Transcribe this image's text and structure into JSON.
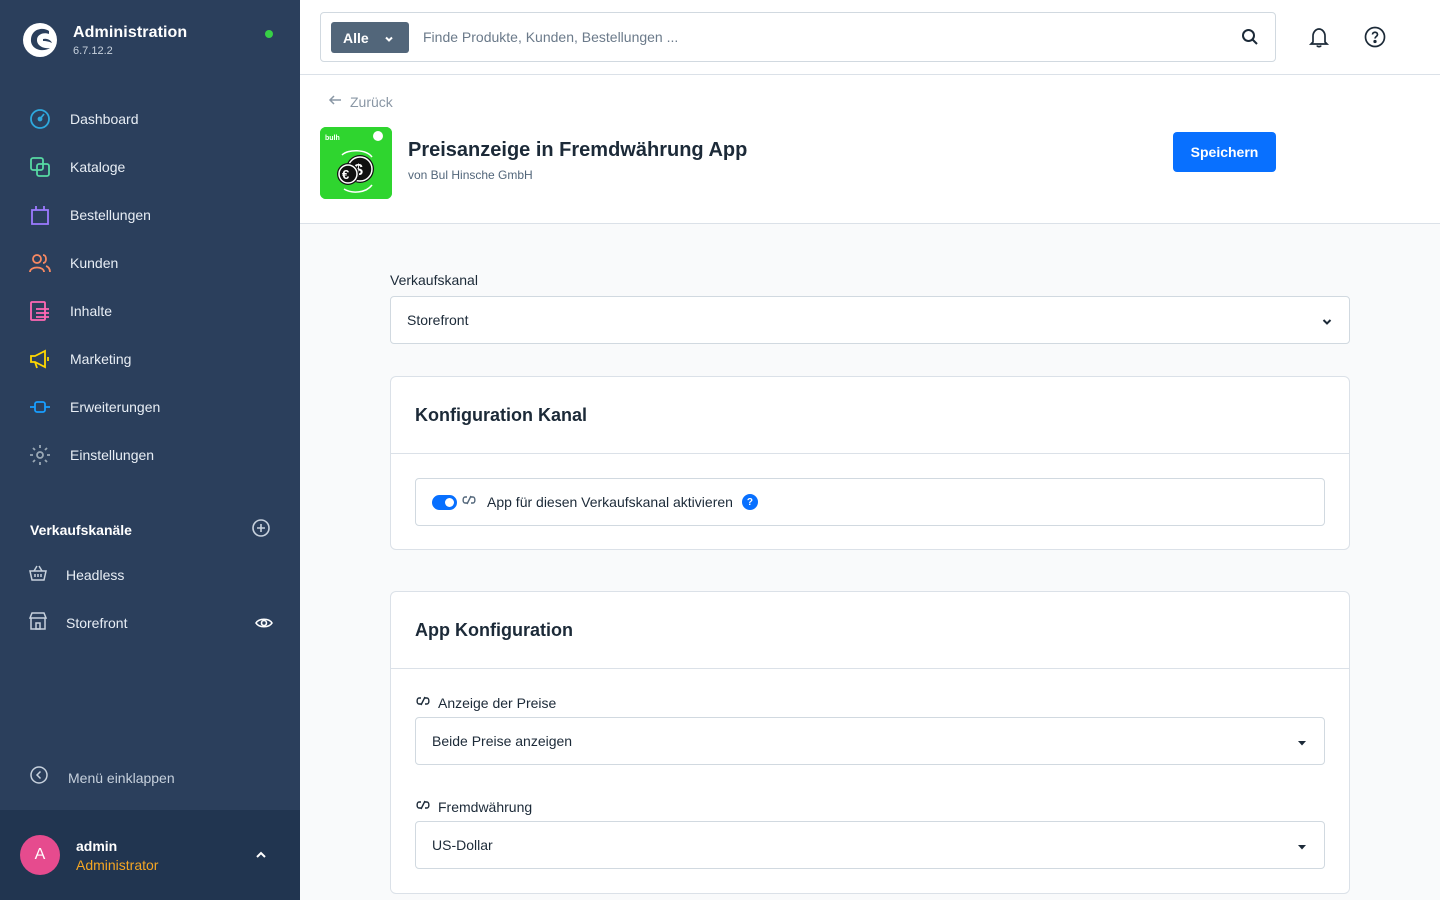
{
  "colors": {
    "sidebar_bg": "#2b3f5c",
    "accent": "#0870ff",
    "user_role": "#f5a623",
    "avatar": "#e64b8e",
    "status_online": "#37d046",
    "app_icon_bg": "#2fd52f"
  },
  "brand": {
    "title": "Administration",
    "version": "6.7.12.2",
    "logo_icon": "shopware-logo-icon"
  },
  "nav": {
    "items": [
      {
        "label": "Dashboard",
        "icon": "dashboard-icon",
        "color": "#2ea8dd"
      },
      {
        "label": "Kataloge",
        "icon": "catalog-icon",
        "color": "#57d9a3"
      },
      {
        "label": "Bestellungen",
        "icon": "orders-icon",
        "color": "#9d7bff"
      },
      {
        "label": "Kunden",
        "icon": "customers-icon",
        "color": "#f88962"
      },
      {
        "label": "Inhalte",
        "icon": "content-icon",
        "color": "#ff68b4"
      },
      {
        "label": "Marketing",
        "icon": "marketing-icon",
        "color": "#ffd700"
      },
      {
        "label": "Erweiterungen",
        "icon": "extensions-icon",
        "color": "#189eff"
      },
      {
        "label": "Einstellungen",
        "icon": "settings-icon",
        "color": "#9aa8b5"
      }
    ]
  },
  "sales_channels": {
    "title": "Verkaufskanäle",
    "items": [
      {
        "label": "Headless",
        "icon": "basket-icon"
      },
      {
        "label": "Storefront",
        "icon": "storefront-icon"
      }
    ]
  },
  "collapse_menu": "Menü einklappen",
  "user": {
    "initial": "A",
    "name": "admin",
    "role": "Administrator"
  },
  "search": {
    "type_label": "Alle",
    "placeholder": "Finde Produkte, Kunden, Bestellungen ..."
  },
  "page": {
    "back_label": "Zurück",
    "app_title": "Preisanzeige in Fremdwährung App",
    "app_vendor": "von Bul Hinsche GmbH",
    "save_label": "Speichern",
    "app_icon_badge": "bulh"
  },
  "sales_channel_select": {
    "label": "Verkaufskanal",
    "value": "Storefront"
  },
  "channel_config": {
    "title": "Konfiguration Kanal",
    "toggle_label": "App für diesen Verkaufskanal aktivieren",
    "toggle_on": true,
    "help_symbol": "?"
  },
  "app_config": {
    "title": "App Konfiguration",
    "fields": [
      {
        "label": "Anzeige der Preise",
        "value": "Beide Preise anzeigen"
      },
      {
        "label": "Fremdwährung",
        "value": "US-Dollar"
      }
    ]
  }
}
